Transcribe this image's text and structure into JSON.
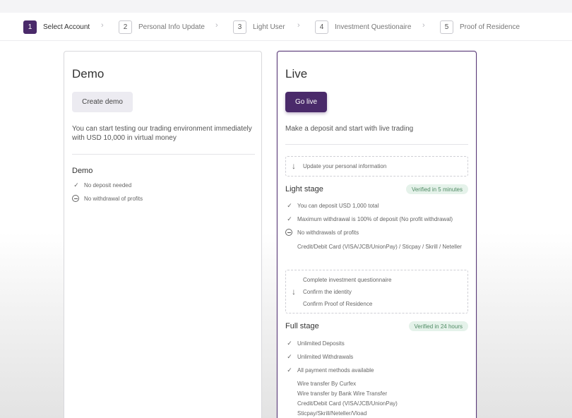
{
  "stepper": {
    "steps": [
      {
        "num": "1",
        "label": "Select Account"
      },
      {
        "num": "2",
        "label": "Personal Info Update"
      },
      {
        "num": "3",
        "label": "Light User"
      },
      {
        "num": "4",
        "label": "Investment Questionaire"
      },
      {
        "num": "5",
        "label": "Proof of Residence"
      }
    ]
  },
  "demo": {
    "title": "Demo",
    "button": "Create demo",
    "description_1": "You can start testing our trading environment immediately",
    "description_2": "with USD 10,000 in virtual money",
    "section_title": "Demo",
    "features": [
      "No deposit needed",
      "No withdrawal of profits"
    ]
  },
  "live": {
    "title": "Live",
    "button": "Go live",
    "description": "Make a deposit and start with live trading",
    "update_info": "Update your personal information",
    "light_stage": {
      "title": "Light stage",
      "badge": "Verified in 5 minutes",
      "features": [
        "You can deposit USD 1,000 total",
        "Maximum withdrawal is 100% of deposit (No profit withdrawal)",
        "No withdrawals of profits"
      ],
      "payment": "Credit/Debit Card (VISA/JCB/UnionPay) / Sticpay / Skrill / Neteller"
    },
    "steps_box": [
      "Complete investment questionnaire",
      "Confirm the identity",
      "Confirm Proof of Residence"
    ],
    "full_stage": {
      "title": "Full stage",
      "badge": "Verified in 24 hours",
      "features": [
        "Unlimited Deposits",
        "Unlimited Withdrawals",
        "All payment methods available"
      ],
      "payments": [
        "Wire transfer By Curfex",
        "Wire transfer by Bank Wire Transfer",
        "Credit/Debit Card (VISA/JCB/UnionPay)",
        "Sticpay/Skrill/Neteller/Vload"
      ]
    }
  },
  "colors": {
    "accent": "#4a2a6a",
    "badge_bg": "#e5f2ea",
    "badge_text": "#4f8a63"
  },
  "icons": {
    "check": "check-icon",
    "minus": "minus-circle-icon",
    "arrow": "arrow-down-icon",
    "chevron": "chevron-right-icon"
  }
}
